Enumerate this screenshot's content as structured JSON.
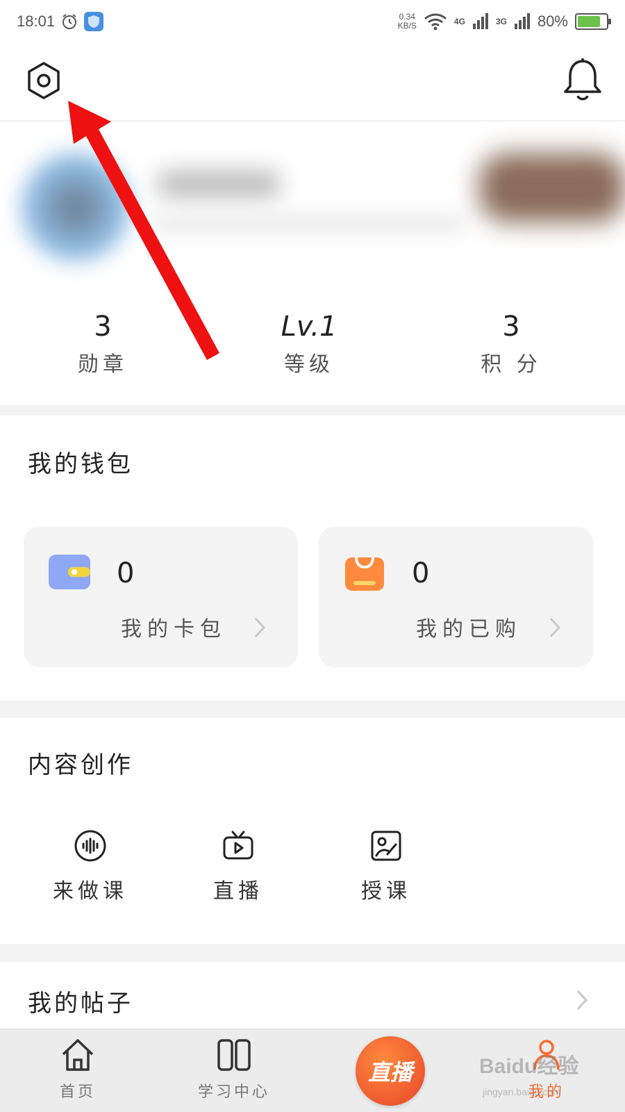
{
  "status_bar": {
    "time": "18:01",
    "net_speed": "0.34",
    "net_speed_unit": "KB/S",
    "network_4g": "4G",
    "network_3g": "3G",
    "battery": "80%",
    "battery_level": 0.8,
    "icons": [
      "alarm-icon",
      "shield-icon",
      "wifi-icon",
      "signal-icon",
      "battery-icon"
    ]
  },
  "header": {
    "icons": [
      "settings-icon",
      "bell-icon"
    ]
  },
  "stats": [
    {
      "value": "3",
      "label": "勋章"
    },
    {
      "value": "Lv.1",
      "label": "等级"
    },
    {
      "value": "3",
      "label": "积 分"
    }
  ],
  "wallet": {
    "title": "我的钱包",
    "cards": [
      {
        "count": "0",
        "label": "我的卡包",
        "icon": "wallet-icon",
        "color": "#8fa8f5"
      },
      {
        "count": "0",
        "label": "我的已购",
        "icon": "shopping-bag-icon",
        "color": "#ff8a3d"
      }
    ]
  },
  "creation": {
    "title": "内容创作",
    "items": [
      {
        "label": "来做课",
        "icon": "audio-icon"
      },
      {
        "label": "直播",
        "icon": "tv-play-icon"
      },
      {
        "label": "授课",
        "icon": "image-edit-icon"
      }
    ]
  },
  "posts": {
    "title": "我的帖子"
  },
  "tabbar": {
    "tabs": [
      {
        "label": "首页",
        "icon": "home-icon"
      },
      {
        "label": "学习中心",
        "icon": "book-icon"
      },
      {
        "label": "直播",
        "icon": "live-icon"
      },
      {
        "label": "我的",
        "icon": "profile-icon"
      }
    ],
    "watermark": "Baidu经验",
    "watermark_sub": "jingyan.baidu.com"
  },
  "colors": {
    "accent": "#ff6a2b",
    "annotation_arrow": "#ee1111"
  }
}
